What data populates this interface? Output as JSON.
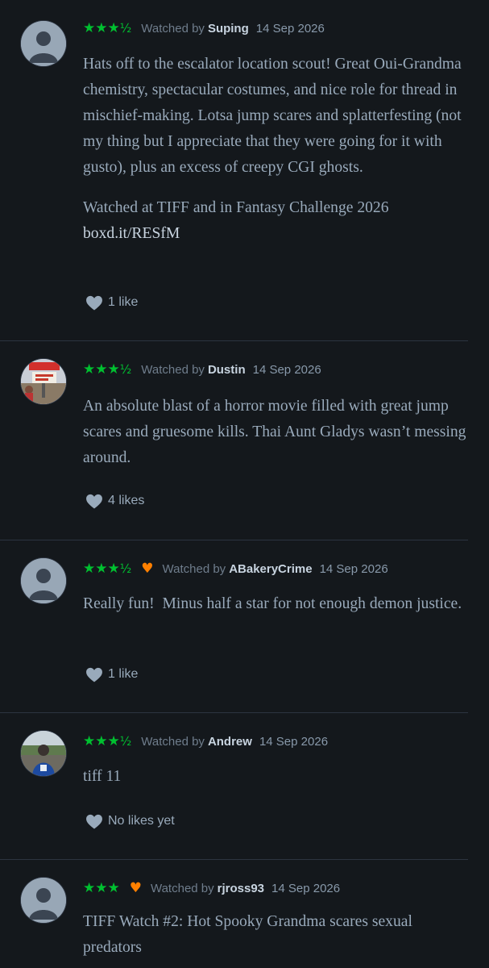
{
  "reviews": [
    {
      "stars": "★★★",
      "half": "½",
      "watched_label": "Watched by",
      "user": "Suping",
      "date": "14 Sep 2026",
      "avatar": "default-avatar",
      "text": "Hats off to the escalator location scout! Great Oui-Grandma chemistry, spectacular costumes, and nice role for thread in mischief-making. Lotsa jump scares and splatterfesting (not my thing but I appreciate that they were going for it with gusto), plus an excess of creepy CGI ghosts.",
      "text2": "Watched at TIFF and in Fantasy Challenge 2026",
      "link": "boxd.it/RESfM",
      "likes": "1 like"
    },
    {
      "stars": "★★★",
      "half": "½",
      "watched_label": "Watched by",
      "user": "Dustin",
      "date": "14 Sep 2026",
      "avatar": "photo-avatar-sign",
      "text": "An absolute blast of a horror movie filled with great jump scares and gruesome kills. Thai Aunt Gladys wasn’t messing around.",
      "likes": "4 likes"
    },
    {
      "stars": "★★★",
      "half": "½",
      "liked": "♥",
      "watched_label": "Watched by",
      "user": "ABakeryCrime",
      "date": "14 Sep 2026",
      "avatar": "default-avatar",
      "text": "Really fun!  Minus half a star for not enough demon justice.",
      "likes": "1 like"
    },
    {
      "stars": "★★★",
      "half": "½",
      "watched_label": "Watched by",
      "user": "Andrew",
      "date": "14 Sep 2026",
      "avatar": "photo-avatar-outdoor",
      "text": "tiff 11",
      "likes": "No likes yet"
    },
    {
      "stars": "★★★",
      "liked": "♥",
      "watched_label": "Watched by",
      "user": "rjross93",
      "date": "14 Sep 2026",
      "avatar": "default-avatar",
      "text": "TIFF Watch #2: Hot Spooky Grandma scares sexual predators"
    }
  ],
  "colors": {
    "background": "#14181c",
    "stars": "#00c030",
    "liked_heart": "#ff8000",
    "text": "#99aabb",
    "username": "#c8d4e0"
  }
}
